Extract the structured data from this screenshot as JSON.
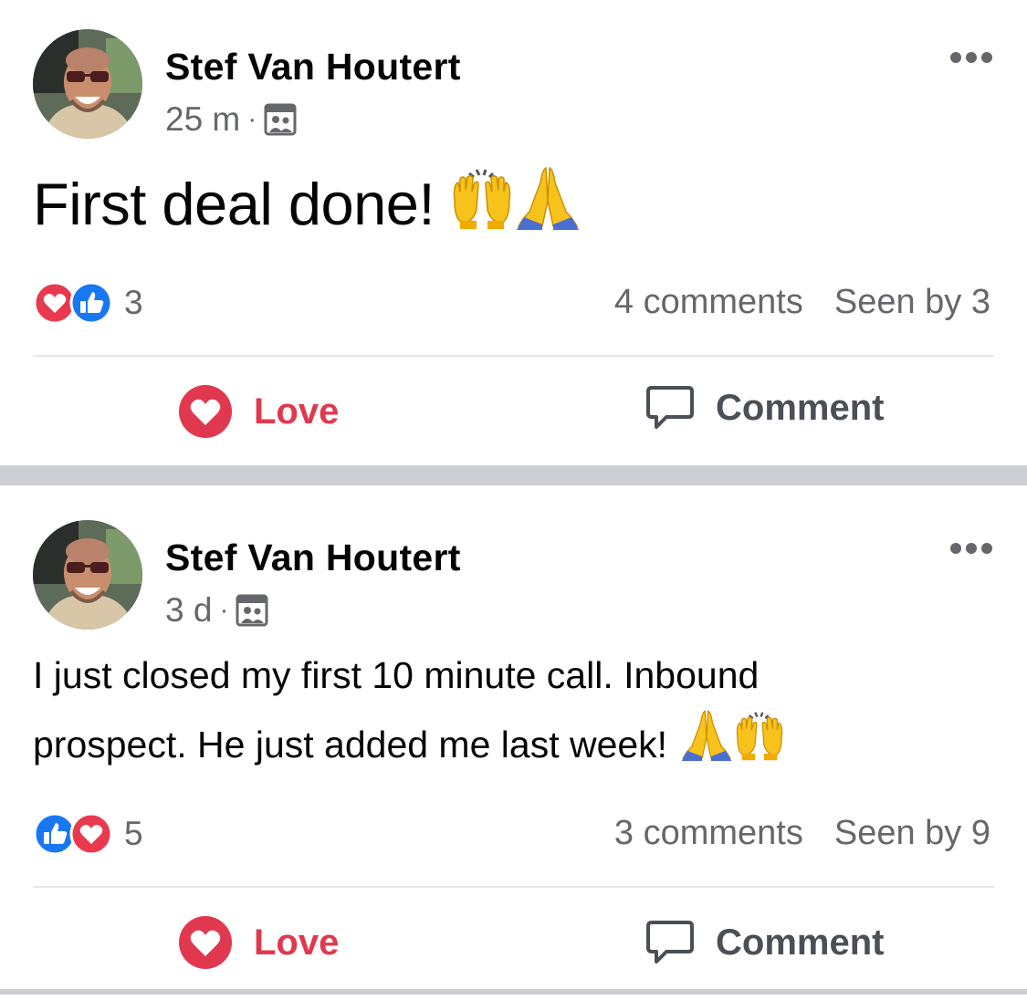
{
  "posts": [
    {
      "author": "Stef Van Houtert",
      "time": "25 m",
      "text_main": "First deal done!",
      "emojis": [
        "raising-hands",
        "folded-hands"
      ],
      "reaction_count": "3",
      "comments": "4 comments",
      "seen": "Seen by 3",
      "love_label": "Love",
      "comment_label": "Comment"
    },
    {
      "author": "Stef Van Houtert",
      "time": "3 d",
      "text_line1": "I just closed my first 10 minute call. Inbound",
      "text_line2": "prospect. He just added me last week!",
      "emojis": [
        "folded-hands",
        "raising-hands"
      ],
      "reaction_count": "5",
      "comments": "3 comments",
      "seen": "Seen by 9",
      "love_label": "Love",
      "comment_label": "Comment"
    }
  ],
  "colors": {
    "love": "#e0394f",
    "like": "#1877f2",
    "muted": "#65676b",
    "separator": "#ccced3"
  },
  "icons": [
    "avatar",
    "more-icon",
    "group-icon",
    "love-reaction-icon",
    "like-reaction-icon",
    "heart-icon",
    "comment-icon",
    "raising-hands-emoji",
    "folded-hands-emoji"
  ]
}
